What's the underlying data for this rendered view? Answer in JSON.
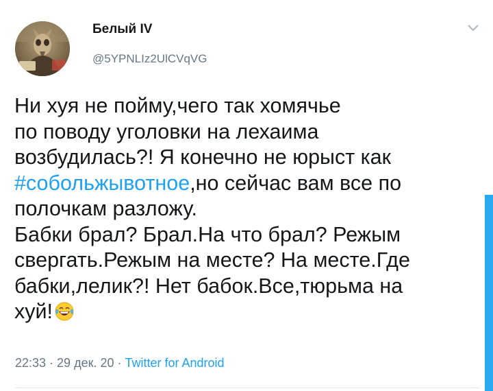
{
  "author": {
    "display_name": "Белый IV",
    "handle": "@5YPNLIz2UlCVqVG",
    "avatar_icon": "avatar-image"
  },
  "menu_icon": "chevron-down-icon",
  "tweet": {
    "lines": [
      {
        "text": "Ни хуя не пойму,чего так хомячье"
      },
      {
        "text": "по поводу уголовки на лехаима"
      },
      {
        "text": "возбудилась?! Я конечно не юрыст как"
      },
      {
        "hashtag": "#собольжывотное",
        "text": ",но сейчас вам все по"
      },
      {
        "text": "полочкам разложу."
      },
      {
        "text": "Бабки брал? Брал.На что брал? Режым"
      },
      {
        "text": "свергать.Режым на месте? На месте.Где"
      },
      {
        "text": "бабки,лелик?! Нет бабок.Все,тюрьма на"
      },
      {
        "text": "хуй!",
        "emoji": "laughing-tears-emoji-icon"
      }
    ]
  },
  "meta": {
    "time": "22:33",
    "separator1": " · ",
    "date": "29 дек. 20",
    "separator2": " · ",
    "source": "Twitter for Android"
  },
  "colors": {
    "text": "#14171a",
    "secondary": "#657786",
    "link": "#1da1f2",
    "scrollbar": "#2aa9f0"
  }
}
